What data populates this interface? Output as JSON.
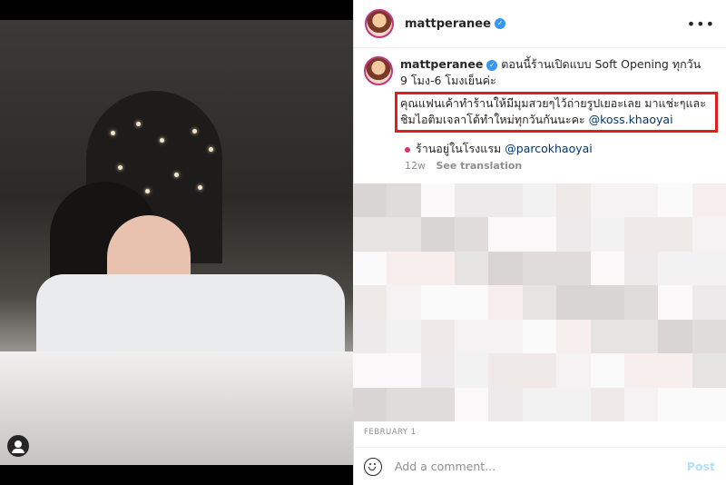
{
  "post": {
    "username": "mattperanee",
    "verified_mark": "✓",
    "more_icon": "•••",
    "caption_line1": "ตอนนี้ร้านเปิดแบบ Soft Opening ทุกวัน 9 โมง-6 โมงเย็นค่ะ",
    "caption_line2": "คุณแฟนเค้าทำร้านให้มีมุมสวยๆไว้ถ่ายรูปเยอะเลย มาแช่ะๆและชิมไอติมเจลาโต้ทำใหม่ทุกวันกันนะคะ ",
    "caption_mention": "@koss.khaoyai",
    "location_text": "ร้านอยู่ในโรงแรม ",
    "location_mention": "@parcokhaoyai",
    "age": "12w",
    "translate": "See translation",
    "date": "FEBRUARY 1",
    "comment_placeholder": "Add a comment...",
    "post_button": "Post"
  },
  "colors": {
    "highlight_box": "#e01e1e",
    "verified": "#3897f0",
    "link": "#00376b",
    "post_button": "#b2dffc"
  },
  "icons": [
    "tag-person-icon",
    "verified-icon",
    "more-options-icon",
    "emoji-icon",
    "location-pin-icon"
  ]
}
